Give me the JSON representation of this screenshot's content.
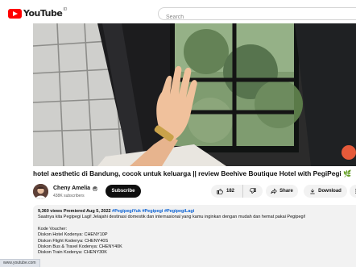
{
  "header": {
    "logo_text": "YouTube",
    "region_code": "ID",
    "search_placeholder": "Search"
  },
  "video": {
    "title": "hotel aesthetic di Bandung, cocok untuk keluarga || review Beehive Boutique Hotel with PegiPegi",
    "title_emoji": "🌿"
  },
  "channel": {
    "name": "Cheny Amelia",
    "subscribers": "438K subscribers",
    "subscribe_label": "Subscribe"
  },
  "actions": {
    "like_count": "182",
    "share_label": "Share",
    "download_label": "Download"
  },
  "description": {
    "views": "9,360 views",
    "premiered": "Premiered Aug 5, 2022",
    "hashtags": "#PegipegiYuk #Pegipegi #PegipegiLagi",
    "line1": "Saatnya kita Pegipegi Lagi! Jelajahi destinasi domestik dan internasional yang kamu inginkan dengan mudah dan hemat pakai Pegipegi!",
    "voucher_heading": "Kode Voucher:",
    "voucher1": "Diskon Hotel Kodenya: CHENY10P",
    "voucher2": "Diskon Flight Kodenya: CHENY40S",
    "voucher3": "Diskon Bus & Travel Kodenya: CHENY40K",
    "voucher4": "Diskon Train Kodenya: CHENY30K"
  },
  "status_bar": {
    "url": "www.youtube.com"
  },
  "colors": {
    "brand_red": "#ff0000",
    "link_blue": "#065fd4",
    "chip_bg": "#f2f2f2"
  },
  "icons": [
    "youtube-logo-icon",
    "like-icon",
    "dislike-icon",
    "share-icon",
    "download-icon",
    "more-icon",
    "verified-icon"
  ]
}
